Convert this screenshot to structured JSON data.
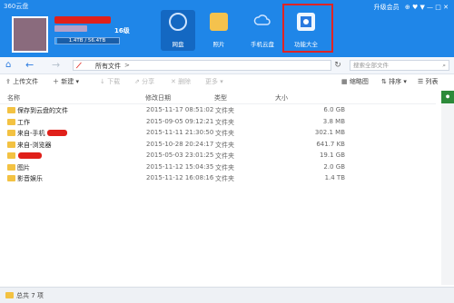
{
  "app": {
    "title": "360云盘"
  },
  "user": {
    "level": "16级",
    "quota_text": "1.4TB / 56.4TB",
    "quota_fraction": 0.025
  },
  "nav": {
    "tiles": [
      {
        "label": "网盘",
        "icon": "cloud-icon",
        "active": true
      },
      {
        "label": "照片",
        "icon": "photo-icon",
        "active": false
      },
      {
        "label": "手机云盘",
        "icon": "mobile-cloud-icon",
        "active": false
      },
      {
        "label": "功能大全",
        "icon": "toolbox-icon",
        "active": false
      }
    ],
    "top_links": {
      "upgrade": "升级会员",
      "icons": "⊕ ♥ ▼ — □ ✕"
    }
  },
  "addressbar": {
    "crumb": "所有文件",
    "crumb_sep": ">",
    "search_placeholder": "搜索全部文件"
  },
  "toolbar": {
    "upload": "上传文件",
    "new": "新建",
    "download": "下载",
    "share": "分享",
    "delete": "删除",
    "more": "更多",
    "view": "缩略图",
    "sort": "排序",
    "list": "列表"
  },
  "table": {
    "headers": {
      "name": "名称",
      "modified": "修改日期",
      "type": "类型",
      "size": "大小"
    },
    "rows": [
      {
        "name": "保存到云盘的文件",
        "date": "2015-11-17 08:51:02",
        "type": "文件夹",
        "size": "6.0 GB"
      },
      {
        "name": "工作",
        "date": "2015-09-05 09:12:21",
        "type": "文件夹",
        "size": "3.8 MB"
      },
      {
        "name": "来自-手机",
        "date": "2015-11-11 21:30:50",
        "type": "文件夹",
        "size": "302.1 MB"
      },
      {
        "name": "来自-浏览器",
        "date": "2015-10-28 20:24:17",
        "type": "文件夹",
        "size": "641.7 KB"
      },
      {
        "name": "",
        "date": "2015-05-03 23:01:25",
        "type": "文件夹",
        "size": "19.1 GB"
      },
      {
        "name": "图片",
        "date": "2015-11-12 15:04:35",
        "type": "文件夹",
        "size": "2.0 GB"
      },
      {
        "name": "影音娱乐",
        "date": "2015-11-12 16:08:16",
        "type": "文件夹",
        "size": "1.4 TB"
      }
    ]
  },
  "status": {
    "text": "总共 7 项"
  },
  "colors": {
    "header": "#1f86e8",
    "highlight": "#e02424",
    "folder": "#f3c242"
  }
}
